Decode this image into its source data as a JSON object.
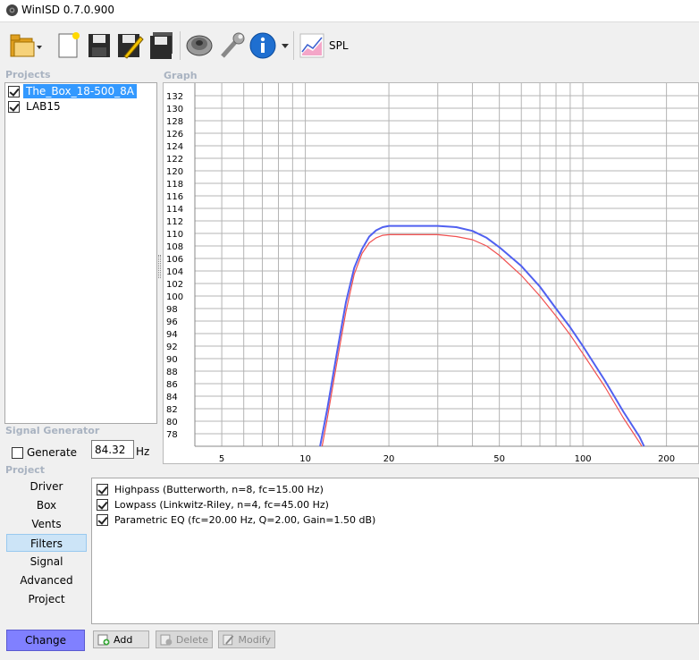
{
  "window": {
    "title": "WinISD 0.7.0.900",
    "icon": "speaker-app-icon"
  },
  "toolbar": {
    "buttons": [
      {
        "name": "open-folder-icon"
      },
      {
        "name": "new-file-icon"
      },
      {
        "name": "save-icon"
      },
      {
        "name": "save-as-icon"
      },
      {
        "name": "save-all-icon"
      },
      {
        "name": "driver-speaker-icon"
      },
      {
        "name": "tools-wrench-icon"
      },
      {
        "name": "info-icon"
      }
    ],
    "spl_label": "SPL"
  },
  "projects": {
    "label": "Projects",
    "items": [
      {
        "name": "The_Box_18-500_8A",
        "checked": true,
        "selected": true
      },
      {
        "name": "LAB15",
        "checked": true,
        "selected": false
      }
    ]
  },
  "graph": {
    "label": "Graph"
  },
  "signal_generator": {
    "label": "Signal Generator",
    "generate_label": "Generate",
    "frequency_value": "84.32",
    "unit": "Hz"
  },
  "project_panel": {
    "label": "Project",
    "nav": [
      "Driver",
      "Box",
      "Vents",
      "Filters",
      "Signal",
      "Advanced",
      "Project"
    ],
    "active": "Filters",
    "change_label": "Change"
  },
  "filters": {
    "items": [
      {
        "label": "Highpass (Butterworth, n=8, fc=15.00 Hz)",
        "checked": true
      },
      {
        "label": "Lowpass (Linkwitz-Riley, n=4, fc=45.00 Hz)",
        "checked": true
      },
      {
        "label": "Parametric EQ (fc=20.00 Hz, Q=2.00, Gain=1.50 dB)",
        "checked": true
      }
    ],
    "actions": {
      "add": "Add",
      "delete": "Delete",
      "modify": "Modify"
    }
  },
  "chart_data": {
    "type": "line",
    "x_scale": "log",
    "xlim": [
      4,
      260
    ],
    "ylim": [
      76,
      134
    ],
    "x_ticks": [
      5,
      10,
      20,
      50,
      100,
      200
    ],
    "y_ticks": [
      78,
      80,
      82,
      84,
      86,
      88,
      90,
      92,
      94,
      96,
      98,
      100,
      102,
      104,
      106,
      108,
      110,
      112,
      114,
      116,
      118,
      120,
      122,
      124,
      126,
      128,
      130,
      132
    ],
    "grid": true,
    "colors": {
      "blue": "#5060f0",
      "red": "#f05050",
      "grid": "#b4b4b4"
    },
    "series": [
      {
        "color": "#5060f0",
        "points": [
          [
            11.3,
            76
          ],
          [
            12,
            82
          ],
          [
            13,
            91
          ],
          [
            14,
            99
          ],
          [
            15,
            104.5
          ],
          [
            16,
            107.5
          ],
          [
            17,
            109.5
          ],
          [
            18,
            110.5
          ],
          [
            19,
            111
          ],
          [
            20,
            111.2
          ],
          [
            25,
            111.2
          ],
          [
            30,
            111.2
          ],
          [
            35,
            111
          ],
          [
            40,
            110.4
          ],
          [
            45,
            109.3
          ],
          [
            50,
            107.8
          ],
          [
            60,
            104.8
          ],
          [
            70,
            101.5
          ],
          [
            80,
            98
          ],
          [
            90,
            95
          ],
          [
            100,
            92
          ],
          [
            120,
            86.5
          ],
          [
            140,
            81.5
          ],
          [
            160,
            77.5
          ],
          [
            166,
            76
          ]
        ]
      },
      {
        "color": "#f05050",
        "points": [
          [
            11.5,
            76
          ],
          [
            12,
            80.5
          ],
          [
            13,
            89.5
          ],
          [
            14,
            97.5
          ],
          [
            15,
            103.5
          ],
          [
            16,
            106.8
          ],
          [
            17,
            108.5
          ],
          [
            18,
            109.3
          ],
          [
            19,
            109.7
          ],
          [
            20,
            109.8
          ],
          [
            25,
            109.8
          ],
          [
            30,
            109.8
          ],
          [
            35,
            109.5
          ],
          [
            40,
            109
          ],
          [
            45,
            108
          ],
          [
            50,
            106.5
          ],
          [
            60,
            103.3
          ],
          [
            70,
            100
          ],
          [
            80,
            96.8
          ],
          [
            90,
            93.8
          ],
          [
            100,
            90.8
          ],
          [
            120,
            85.5
          ],
          [
            140,
            80.5
          ],
          [
            160,
            76.6
          ],
          [
            163,
            76
          ]
        ]
      }
    ]
  }
}
